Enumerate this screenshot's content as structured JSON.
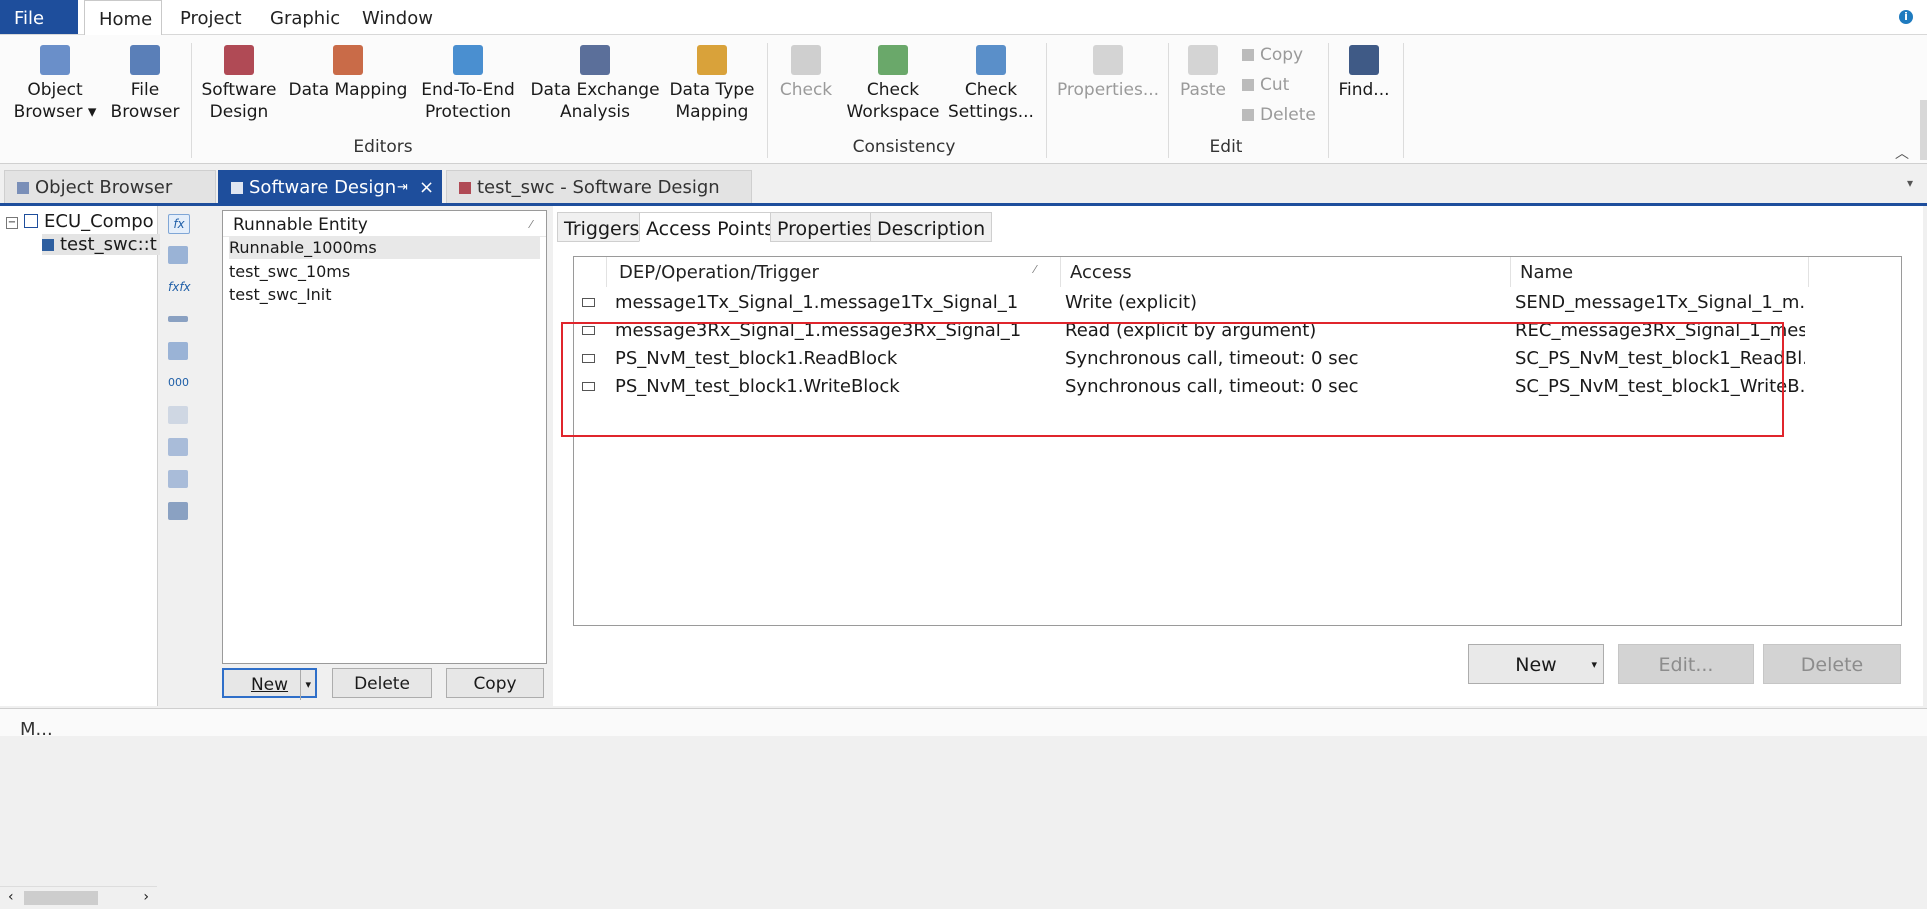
{
  "menu": {
    "file": "File",
    "home": "Home",
    "project": "Project",
    "graphic": "Graphic",
    "window": "Window"
  },
  "ribbon": {
    "object_browser_l1": "Object",
    "object_browser_l2": "Browser",
    "file_browser_l1": "File",
    "file_browser_l2": "Browser",
    "software_design_l1": "Software",
    "software_design_l2": "Design",
    "data_mapping": "Data Mapping",
    "e2e_l1": "End-To-End",
    "e2e_l2": "Protection",
    "dx_l1": "Data Exchange",
    "dx_l2": "Analysis",
    "dtm_l1": "Data Type",
    "dtm_l2": "Mapping",
    "editors_group": "Editors",
    "check": "Check",
    "check_ws_l1": "Check",
    "check_ws_l2": "Workspace",
    "check_set_l1": "Check",
    "check_set_l2": "Settings...",
    "consistency_group": "Consistency",
    "properties": "Properties...",
    "paste": "Paste",
    "copy": "Copy",
    "cut": "Cut",
    "delete": "Delete",
    "find": "Find...",
    "edit_group": "Edit"
  },
  "doc_tabs": {
    "object_browser": "Object Browser",
    "software_design": "Software Design",
    "pin": "⇥",
    "close": "×",
    "test_swc": "test_swc - Software Design"
  },
  "tree": {
    "root": "ECU_Compo",
    "child": "test_swc::t"
  },
  "runnables": {
    "header": "Runnable Entity",
    "items": [
      "Runnable_1000ms",
      "test_swc_10ms",
      "test_swc_Init"
    ],
    "new": "New",
    "delete": "Delete",
    "copy": "Copy"
  },
  "detail_tabs": {
    "triggers": "Triggers",
    "access_points": "Access Points",
    "properties": "Properties",
    "description": "Description"
  },
  "grid": {
    "headers": [
      "DEP/Operation/Trigger",
      "Access",
      "Name"
    ],
    "rows": [
      {
        "dep": "message1Tx_Signal_1.message1Tx_Signal_1",
        "access": "Write (explicit)",
        "name": "SEND_message1Tx_Signal_1_m..."
      },
      {
        "dep": "message3Rx_Signal_1.message3Rx_Signal_1",
        "access": "Read (explicit by argument)",
        "name": "REC_message3Rx_Signal_1_mes..."
      },
      {
        "dep": "PS_NvM_test_block1.ReadBlock",
        "access": "Synchronous call, timeout: 0 sec",
        "name": "SC_PS_NvM_test_block1_ReadBl..."
      },
      {
        "dep": "PS_NvM_test_block1.WriteBlock",
        "access": "Synchronous call, timeout: 0 sec",
        "name": "SC_PS_NvM_test_block1_WriteB..."
      }
    ],
    "new": "New",
    "edit": "Edit...",
    "delete": "Delete"
  },
  "status": {
    "text": "M..."
  },
  "colors": {
    "accent": "#1e4e9c",
    "highlight": "#e0252c"
  }
}
